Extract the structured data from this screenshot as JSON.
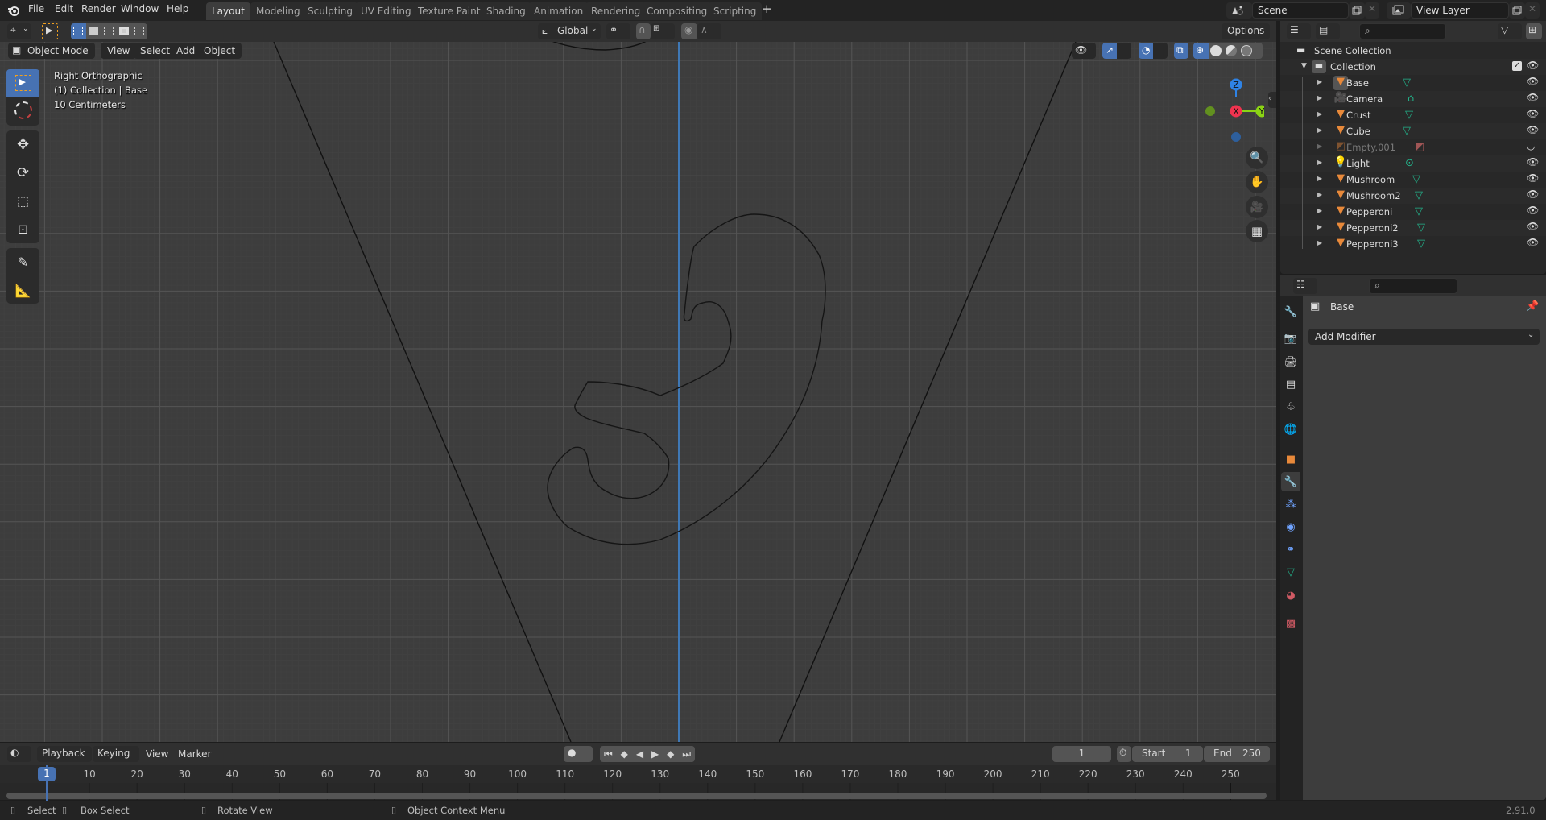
{
  "topbar": {
    "menus": [
      "File",
      "Edit",
      "Render",
      "Window",
      "Help"
    ],
    "workspaces": [
      {
        "label": "Layout",
        "active": true
      },
      {
        "label": "Modeling",
        "active": false
      },
      {
        "label": "Sculpting",
        "active": false
      },
      {
        "label": "UV Editing",
        "active": false
      },
      {
        "label": "Texture Paint",
        "active": false
      },
      {
        "label": "Shading",
        "active": false
      },
      {
        "label": "Animation",
        "active": false
      },
      {
        "label": "Rendering",
        "active": false
      },
      {
        "label": "Compositing",
        "active": false
      },
      {
        "label": "Scripting",
        "active": false
      }
    ],
    "add_workspace": "+",
    "scene": "Scene",
    "view_layer": "View Layer"
  },
  "viewport": {
    "transform_orientation": "Global",
    "options_label": "Options",
    "mode": "Object Mode",
    "menus": [
      "View",
      "Select",
      "Add",
      "Object"
    ],
    "overlay_lines": [
      "Right Orthographic",
      "(1) Collection | Base",
      "10 Centimeters"
    ],
    "gizmo": {
      "z": "Z",
      "x": "X",
      "y": "Y"
    },
    "colors": {
      "background": "#3d3d3d",
      "axis_z": "#2f83e5",
      "axis_x": "#f0334f",
      "axis_y": "#8bd414",
      "active_tool": "#4772b3",
      "grid_axis": "#3f78b5"
    }
  },
  "timeline": {
    "menus": [
      "Playback",
      "Keying",
      "View",
      "Marker"
    ],
    "current_frame": "1",
    "start_label": "Start",
    "start_value": "1",
    "end_label": "End",
    "end_value": "250",
    "ticks": [
      "10",
      "20",
      "30",
      "40",
      "50",
      "60",
      "70",
      "80",
      "90",
      "100",
      "110",
      "120",
      "130",
      "140",
      "150",
      "160",
      "170",
      "180",
      "190",
      "200",
      "210",
      "220",
      "230",
      "240",
      "250"
    ],
    "playhead_label": "1"
  },
  "outliner": {
    "scene_collection": "Scene Collection",
    "collection": "Collection",
    "items": [
      {
        "name": "Base",
        "type": "mesh",
        "data": "mesh",
        "visible": true,
        "selected": true
      },
      {
        "name": "Camera",
        "type": "camera",
        "data": "camera",
        "visible": true
      },
      {
        "name": "Crust",
        "type": "mesh",
        "data": "mesh",
        "visible": true
      },
      {
        "name": "Cube",
        "type": "mesh",
        "data": "mesh",
        "visible": true
      },
      {
        "name": "Empty.001",
        "type": "image",
        "data": "image",
        "visible": false
      },
      {
        "name": "Light",
        "type": "light",
        "data": "light",
        "visible": true
      },
      {
        "name": "Mushroom",
        "type": "mesh",
        "data": "mesh",
        "visible": true
      },
      {
        "name": "Mushroom2",
        "type": "mesh",
        "data": "mesh",
        "visible": true
      },
      {
        "name": "Pepperoni",
        "type": "mesh",
        "data": "mesh",
        "visible": true
      },
      {
        "name": "Pepperoni2",
        "type": "mesh",
        "data": "mesh",
        "visible": true
      },
      {
        "name": "Pepperoni3",
        "type": "mesh",
        "data": "mesh",
        "visible": true
      }
    ]
  },
  "properties": {
    "object_name": "Base",
    "add_modifier": "Add Modifier",
    "tabs": [
      "tool",
      "render",
      "output",
      "view-layer",
      "scene",
      "world",
      "object",
      "modifiers",
      "particles",
      "physics",
      "constraints",
      "data",
      "material",
      "texture"
    ],
    "active_tab": "modifiers"
  },
  "statusbar": {
    "items": [
      "Select",
      "Box Select",
      "Rotate View",
      "Object Context Menu"
    ],
    "version": "2.91.0"
  }
}
